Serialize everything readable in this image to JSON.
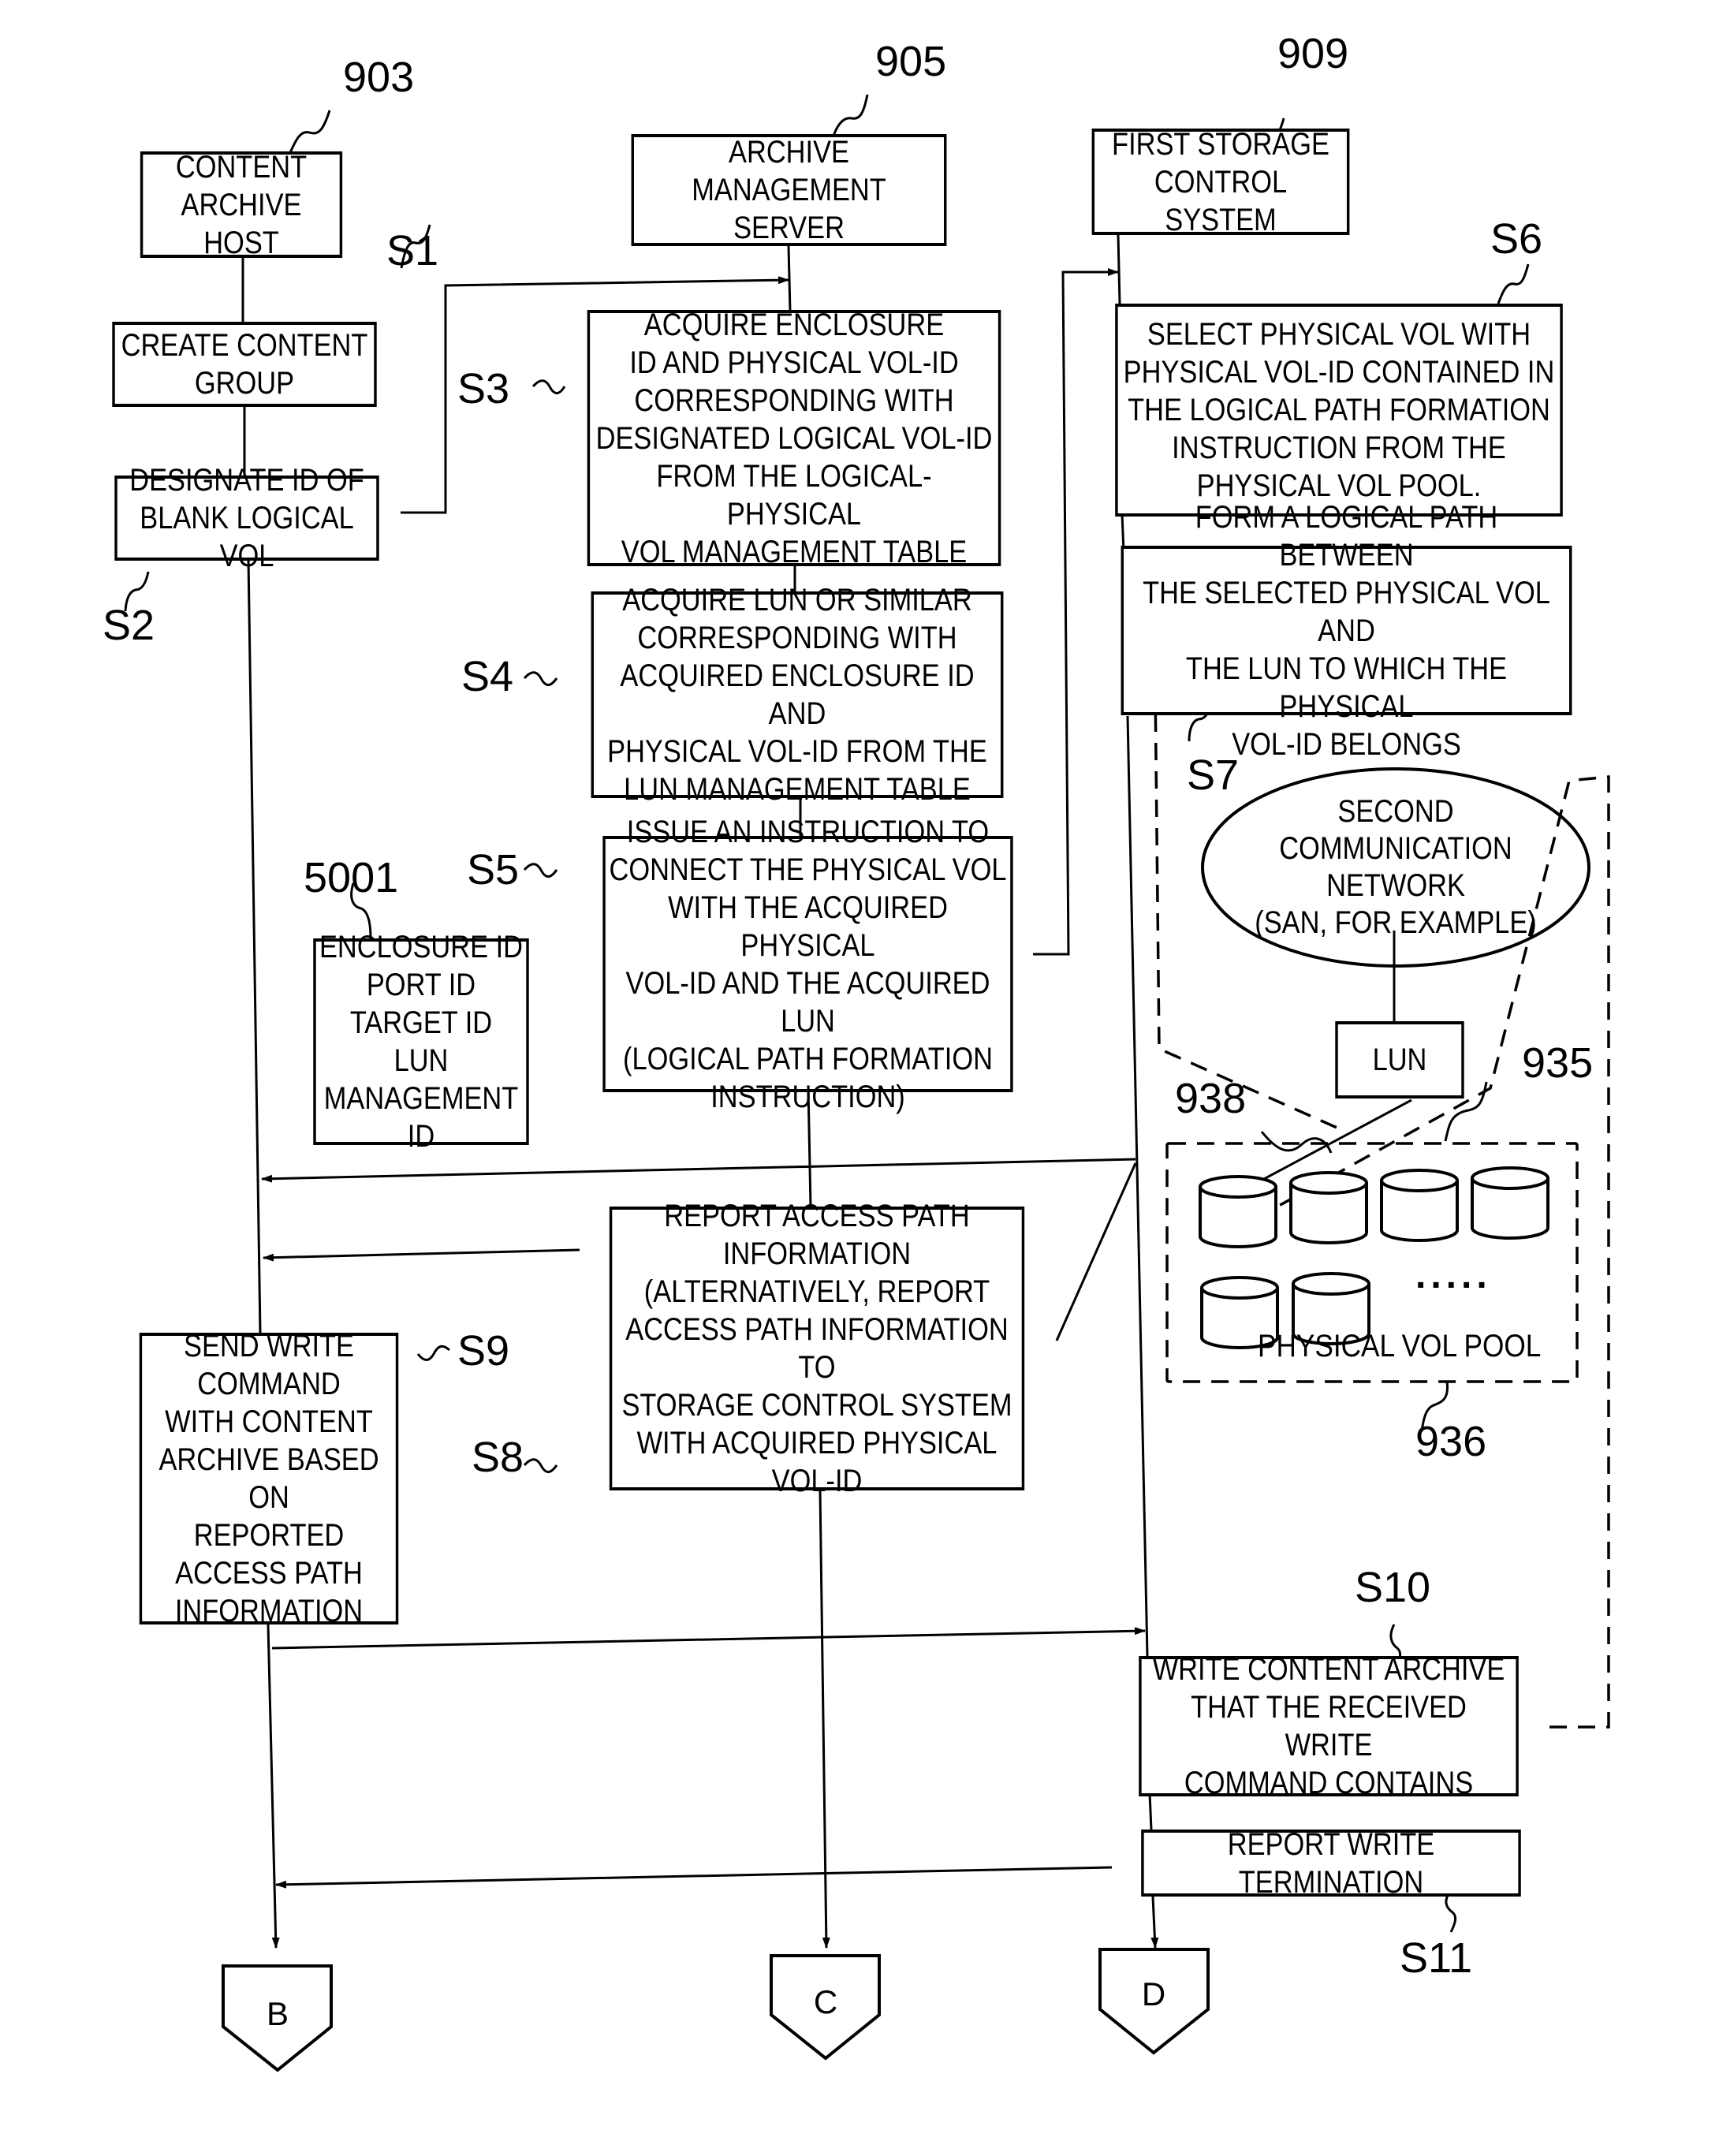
{
  "actors": {
    "host": {
      "ref": "903",
      "label": "CONTENT\nARCHIVE HOST"
    },
    "server": {
      "ref": "905",
      "label": "ARCHIVE MANAGEMENT\nSERVER"
    },
    "storage": {
      "ref": "909",
      "label": "FIRST STORAGE\nCONTROL SYSTEM"
    }
  },
  "steps": {
    "s1": {
      "ref": "S1",
      "label": "CREATE CONTENT\nGROUP"
    },
    "s2": {
      "ref": "S2",
      "label": "DESIGNATE ID OF\nBLANK LOGICAL VOL"
    },
    "s3": {
      "ref": "S3",
      "label": "ACQUIRE ENCLOSURE\nID AND PHYSICAL VOL-ID\nCORRESPONDING WITH\nDESIGNATED LOGICAL VOL-ID\nFROM THE LOGICAL-PHYSICAL\nVOL MANAGEMENT TABLE"
    },
    "s4": {
      "ref": "S4",
      "label": "ACQUIRE LUN OR SIMILAR\nCORRESPONDING WITH\nACQUIRED ENCLOSURE ID AND\nPHYSICAL VOL-ID FROM THE\nLUN MANAGEMENT TABLE"
    },
    "s5": {
      "ref": "S5",
      "label": "ISSUE AN INSTRUCTION TO\nCONNECT THE PHYSICAL VOL\nWITH THE ACQUIRED PHYSICAL\nVOL-ID AND THE ACQUIRED LUN\n(LOGICAL PATH FORMATION\nINSTRUCTION)"
    },
    "s6": {
      "ref": "S6",
      "label": "SELECT PHYSICAL VOL WITH\nPHYSICAL VOL-ID CONTAINED IN\nTHE LOGICAL PATH FORMATION\nINSTRUCTION FROM THE\nPHYSICAL VOL POOL."
    },
    "s7": {
      "ref": "S7",
      "label": "FORM A LOGICAL PATH BETWEEN\nTHE SELECTED PHYSICAL VOL AND\nTHE LUN TO WHICH THE PHYSICAL\nVOL-ID BELONGS"
    },
    "s8": {
      "ref": "S8",
      "label": "REPORT ACCESS PATH\nINFORMATION\n(ALTERNATIVELY, REPORT\nACCESS PATH INFORMATION TO\nSTORAGE CONTROL SYSTEM\nWITH ACQUIRED PHYSICAL\nVOL-ID"
    },
    "s9": {
      "ref": "S9",
      "label": "SEND WRITE\nCOMMAND\nWITH CONTENT\nARCHIVE BASED ON\nREPORTED\nACCESS PATH\nINFORMATION"
    },
    "s10": {
      "ref": "S10",
      "label": "WRITE CONTENT ARCHIVE\nTHAT THE RECEIVED WRITE\nCOMMAND CONTAINS"
    },
    "s11": {
      "ref": "S11",
      "label": "REPORT WRITE TERMINATION"
    }
  },
  "lun_info": {
    "ref": "5001",
    "label": "ENCLOSURE ID\nPORT ID\nTARGET ID\nLUN\nMANAGEMENT ID"
  },
  "network": {
    "label": "SECOND\nCOMMUNICATION\nNETWORK\n(SAN, FOR EXAMPLE)"
  },
  "lun_box": {
    "label": "LUN"
  },
  "pool": {
    "ref": "936",
    "label": "PHYSICAL VOL POOL",
    "volume_ref": "935",
    "path_ref": "938",
    "ellipsis": "....."
  },
  "connectors": {
    "b": "B",
    "c": "C",
    "d": "D"
  }
}
